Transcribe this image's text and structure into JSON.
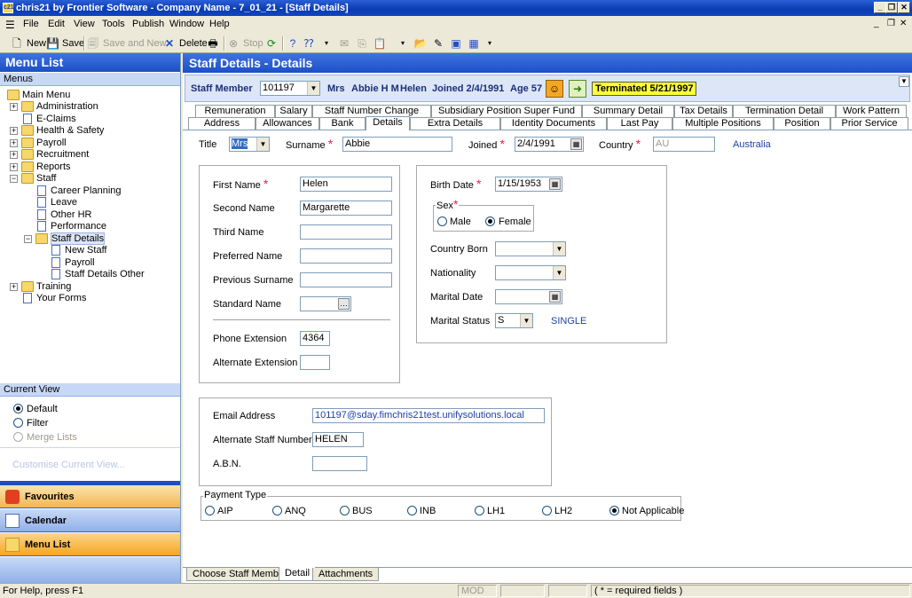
{
  "window": {
    "title": "chris21 by Frontier Software - Company Name - 7_01_21 - [Staff Details]"
  },
  "menubar": {
    "items": [
      "File",
      "Edit",
      "View",
      "Tools",
      "Publish",
      "Window",
      "Help"
    ]
  },
  "toolbar": {
    "new": "New",
    "save": "Save",
    "save_and_new": "Save and New",
    "delete": "Delete",
    "stop": "Stop"
  },
  "left": {
    "title": "Menu List",
    "menus_label": "Menus",
    "tree": {
      "main_menu": "Main Menu",
      "administration": "Administration",
      "e_claims": "E-Claims",
      "health_safety": "Health & Safety",
      "payroll": "Payroll",
      "recruitment": "Recruitment",
      "reports": "Reports",
      "staff": "Staff",
      "career_planning": "Career Planning",
      "leave": "Leave",
      "other_hr": "Other HR",
      "performance": "Performance",
      "staff_details": "Staff Details",
      "new_staff": "New Staff",
      "staff_payroll": "Payroll",
      "staff_details_other": "Staff Details Other",
      "training": "Training",
      "your_forms": "Your Forms"
    },
    "current_view": {
      "label": "Current View",
      "default": "Default",
      "filter": "Filter",
      "merge_lists": "Merge Lists",
      "customise": "Customise Current View..."
    },
    "nav": {
      "favourites": "Favourites",
      "calendar": "Calendar",
      "menu_list": "Menu List"
    }
  },
  "content": {
    "title": "Staff Details - Details",
    "staff_bar": {
      "label": "Staff Member",
      "id": "101197",
      "title": "Mrs",
      "name": "Abbie H M",
      "first": "Helen",
      "joined": "Joined 2/4/1991",
      "age": "Age 57",
      "terminated": "Terminated 5/21/1997"
    },
    "tabs_row1": [
      "Remuneration",
      "Salary",
      "Staff Number Change",
      "Subsidiary Position Super Fund",
      "Summary Detail",
      "Tax Details",
      "Termination Detail",
      "Work Pattern"
    ],
    "tabs_row2": [
      "Address",
      "Allowances",
      "Bank",
      "Details",
      "Extra Details",
      "Identity Documents",
      "Last Pay",
      "Multiple Positions",
      "Position",
      "Prior Service"
    ],
    "form": {
      "title_label": "Title",
      "title_value": "Mrs",
      "surname_label": "Surname",
      "surname_value": "Abbie",
      "joined_label": "Joined",
      "joined_value": "2/4/1991",
      "country_label": "Country",
      "country_value": "AU",
      "country_name": "Australia",
      "first_name_label": "First Name",
      "first_name_value": "Helen",
      "second_name_label": "Second Name",
      "second_name_value": "Margarette",
      "third_name_label": "Third Name",
      "preferred_name_label": "Preferred Name",
      "previous_surname_label": "Previous Surname",
      "standard_name_label": "Standard Name",
      "phone_ext_label": "Phone Extension",
      "phone_ext_value": "4364",
      "alt_ext_label": "Alternate Extension",
      "birth_date_label": "Birth Date",
      "birth_date_value": "1/15/1953",
      "sex_label": "Sex",
      "male": "Male",
      "female": "Female",
      "country_born_label": "Country Born",
      "nationality_label": "Nationality",
      "marital_date_label": "Marital Date",
      "marital_status_label": "Marital Status",
      "marital_status_value": "S",
      "marital_status_text": "SINGLE",
      "email_label": "Email Address",
      "email_value": "101197@sday.fimchris21test.unifysolutions.local",
      "alt_staff_label": "Alternate Staff Number",
      "alt_staff_value": "HELEN",
      "abn_label": "A.B.N.",
      "payment_type_label": "Payment Type",
      "payment_options": [
        "AIP",
        "ANQ",
        "BUS",
        "INB",
        "LH1",
        "LH2",
        "Not Applicable"
      ]
    },
    "bottom_tabs": [
      "Choose Staff Member",
      "Detail",
      "Attachments"
    ]
  },
  "status": {
    "help": "For Help, press F1",
    "mod": "MOD",
    "required": "( * = required fields )"
  }
}
